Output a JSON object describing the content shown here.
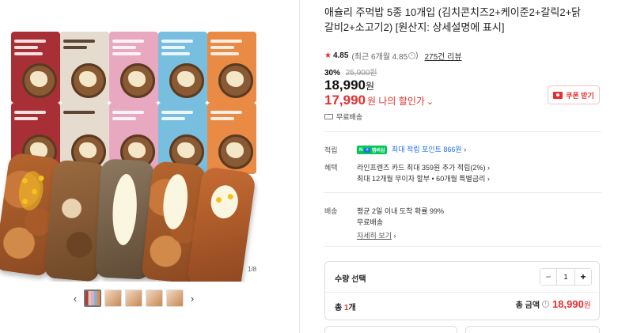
{
  "gallery": {
    "page_indicator": "1/8",
    "prev_arrow": "‹",
    "next_arrow": "›",
    "thumbnail_count": 5,
    "active_thumbnail": 1
  },
  "product": {
    "title": "애슐리 주먹밥 5종 10개입 (김치콘치즈2+케이준2+갈릭2+닭갈비2+소고기2) [원산지: 상세설명에 표시]",
    "rating": "4.85",
    "rating_recent": "(최근 6개월 4.85",
    "rating_info_icon": "i",
    "rating_recent_close": ")",
    "review_count": "275건 리뷰"
  },
  "price": {
    "discount_rate": "30%",
    "original_price": "25,900원",
    "sale_price": "18,990",
    "sale_currency": "원",
    "my_price": "17,990",
    "my_price_label": "원 나의 할인가",
    "my_price_chevron": "⌄",
    "coupon_button": "쿠폰 받기"
  },
  "shipping": {
    "free_shipping": "무료배송"
  },
  "details": {
    "points_label": "적립",
    "npay_badge": "N",
    "npay_plus": "+",
    "npay_member": "멤버십",
    "points_text": "최대 적립 포인트 866원",
    "points_chevron": "›",
    "benefits_label": "혜택",
    "benefit_line1": "라인프렌즈 카드 최대 359원 추가 적립(2%)",
    "benefit_line1_chevron": "›",
    "benefit_line2": "최대 12개월 무이자 할부 • 60개월 특별금리",
    "benefit_line2_chevron": "›",
    "delivery_label": "배송",
    "delivery_line1": "평균 2일 이내 도착 확률 99%",
    "delivery_line2": "무료배송",
    "more_link": "자세히 보기",
    "more_chevron": "›"
  },
  "purchase": {
    "qty_label": "수량 선택",
    "minus": "−",
    "quantity": "1",
    "plus": "+",
    "total_prefix": "총 ",
    "total_count": "1",
    "total_count_suffix": "개",
    "total_amount_label": "총 금액",
    "total_amount_info": "i",
    "total_amount": "18,990",
    "total_amount_won": "원"
  },
  "colors": {
    "accent_red": "#e62e2e",
    "point_blue": "#1e6fe8",
    "npay_green": "#03c75a"
  }
}
